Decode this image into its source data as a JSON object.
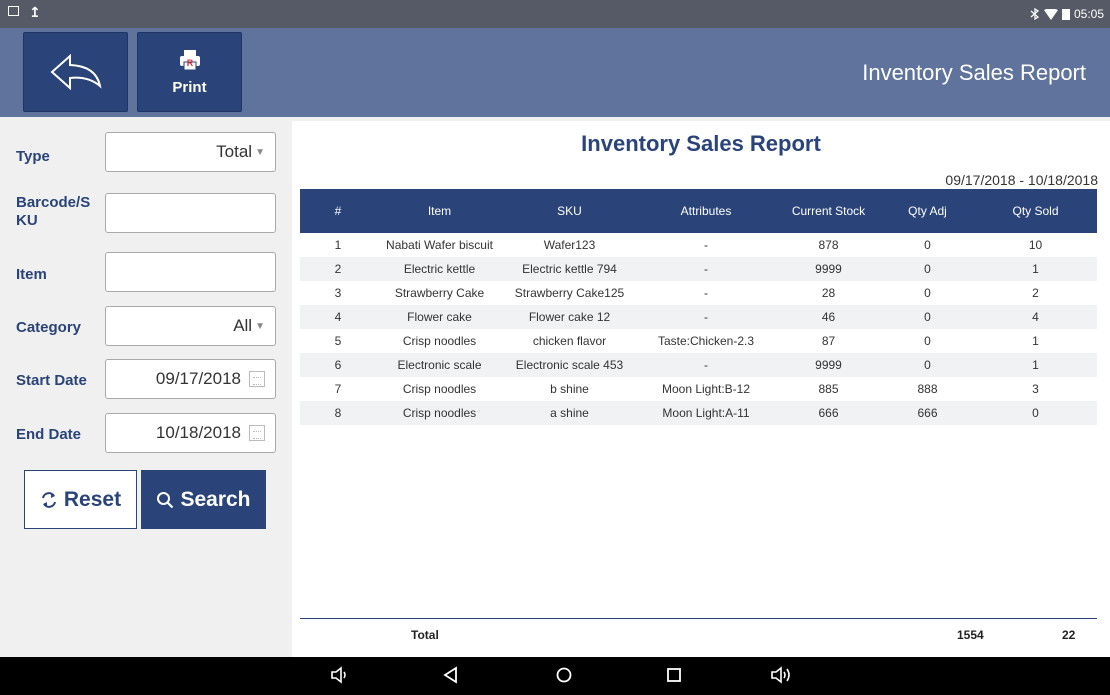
{
  "status": {
    "time": "05:05"
  },
  "header": {
    "back_icon": "back-arrow-icon",
    "print_label": "Print",
    "title": "Inventory Sales Report"
  },
  "filters": {
    "type_label": "Type",
    "type_value": "Total",
    "barcode_label": "Barcode/S\nKU",
    "barcode_value": "",
    "item_label": "Item",
    "item_value": "",
    "category_label": "Category",
    "category_value": "All",
    "start_label": "Start Date",
    "start_value": "09/17/2018",
    "end_label": "End Date",
    "end_value": "10/18/2018",
    "reset_label": "Reset",
    "search_label": "Search"
  },
  "report": {
    "title": "Inventory Sales Report",
    "date_range": "09/17/2018 - 10/18/2018",
    "columns": [
      "#",
      "Item",
      "SKU",
      "Attributes",
      "Current Stock",
      "Qty Adj",
      "Qty Sold"
    ],
    "rows": [
      [
        "1",
        "Nabati Wafer biscuit",
        "Wafer123",
        "-",
        "878",
        "0",
        "10"
      ],
      [
        "2",
        "Electric kettle",
        "Electric kettle 794",
        "-",
        "9999",
        "0",
        "1"
      ],
      [
        "3",
        "Strawberry Cake",
        "Strawberry Cake125",
        "-",
        "28",
        "0",
        "2"
      ],
      [
        "4",
        "Flower cake",
        "Flower cake 12",
        "-",
        "46",
        "0",
        "4"
      ],
      [
        "5",
        "Crisp noodles",
        "chicken flavor",
        "Taste:Chicken-2.3",
        "87",
        "0",
        "1"
      ],
      [
        "6",
        "Electronic scale",
        "Electronic scale 453",
        "-",
        "9999",
        "0",
        "1"
      ],
      [
        "7",
        "Crisp noodles",
        "b shine",
        "Moon Light:B-12",
        "885",
        "888",
        "3"
      ],
      [
        "8",
        "Crisp noodles",
        "a shine",
        "Moon Light:A-11",
        "666",
        "666",
        "0"
      ]
    ],
    "total_label": "Total",
    "total_qty_adj": "1554",
    "total_qty_sold": "22"
  },
  "colors": {
    "primary": "#2a4378",
    "header_bg": "#60739c",
    "status_bg": "#555a66"
  }
}
